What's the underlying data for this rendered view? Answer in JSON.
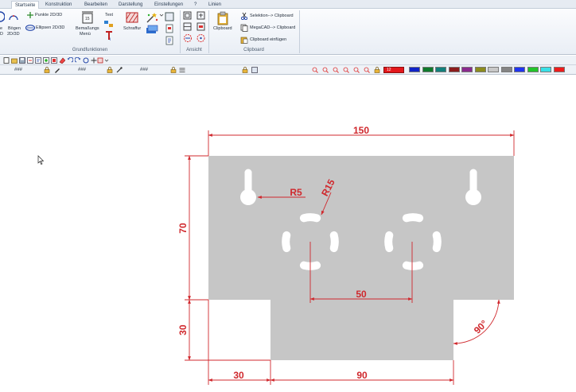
{
  "tabs": [
    {
      "label": "Startseite",
      "active": true
    },
    {
      "label": "Konstruktion"
    },
    {
      "label": "Bearbeiten"
    },
    {
      "label": "Darstellung"
    },
    {
      "label": "Einstellungen"
    },
    {
      "label": "?"
    },
    {
      "label": "Linien"
    }
  ],
  "ribbon": {
    "grundfunktionen": {
      "label": "Grundfunktionen",
      "punkte": "Punkte 2D/3D",
      "boegen_1": "Bögen",
      "boegen_2": "2D/3D",
      "ellipsen": "Ellipsen 2D/3D",
      "left_1": "e",
      "left_2": "D",
      "bemassungs_1": "Bemaßungs",
      "bemassungs_2": "Menü",
      "text": "Text",
      "schraffur": "Schraffur"
    },
    "ansicht": {
      "label": "Ansicht"
    },
    "clipboard": {
      "label": "Clipboard",
      "button": "Clipboard",
      "selektion": "Selektion--> Clipboard",
      "megacad": "MegaCAD--> Clipboard",
      "einfuegen": "Clipboard einfügen"
    }
  },
  "toolbar2": {
    "field_1": "###",
    "field_2": "###",
    "field_3": "###",
    "color_value": "12",
    "swatches": [
      "#1024c8",
      "#0f7a2c",
      "#12807c",
      "#8c1c1c",
      "#8a2a8e",
      "#8c8c1e",
      "#c8c8c8",
      "#848484",
      "#2035f0",
      "#22c42a",
      "#38e0e6",
      "#ee1c1c"
    ]
  },
  "drawing": {
    "dimensions": {
      "top_width": "150",
      "left_height": "70",
      "lower_left_height": "30",
      "bottom_left_width": "30",
      "bottom_width": "90",
      "center_distance": "50",
      "small_radius": "R5",
      "large_radius": "R15",
      "angle": "90°"
    },
    "colors": {
      "plate": "#c6c6c6",
      "dimension": "#d0282d"
    }
  }
}
